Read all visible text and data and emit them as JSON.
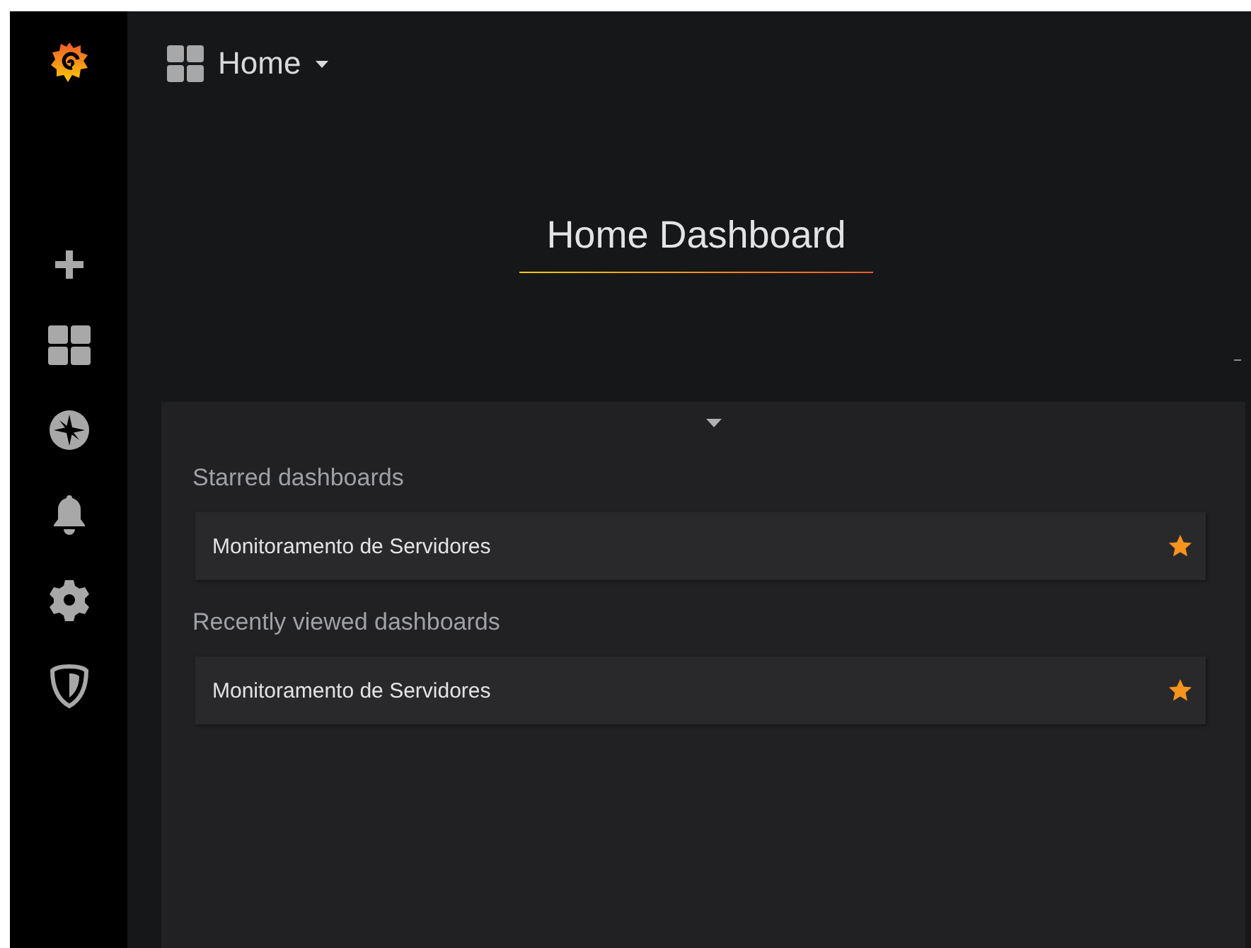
{
  "header": {
    "title": "Home"
  },
  "dashboard_title": "Home Dashboard",
  "sections": [
    {
      "heading": "Starred dashboards",
      "items": [
        {
          "label": "Monitoramento de Servidores",
          "starred": true
        }
      ]
    },
    {
      "heading": "Recently viewed dashboards",
      "items": [
        {
          "label": "Monitoramento de Servidores",
          "starred": true
        }
      ]
    }
  ]
}
